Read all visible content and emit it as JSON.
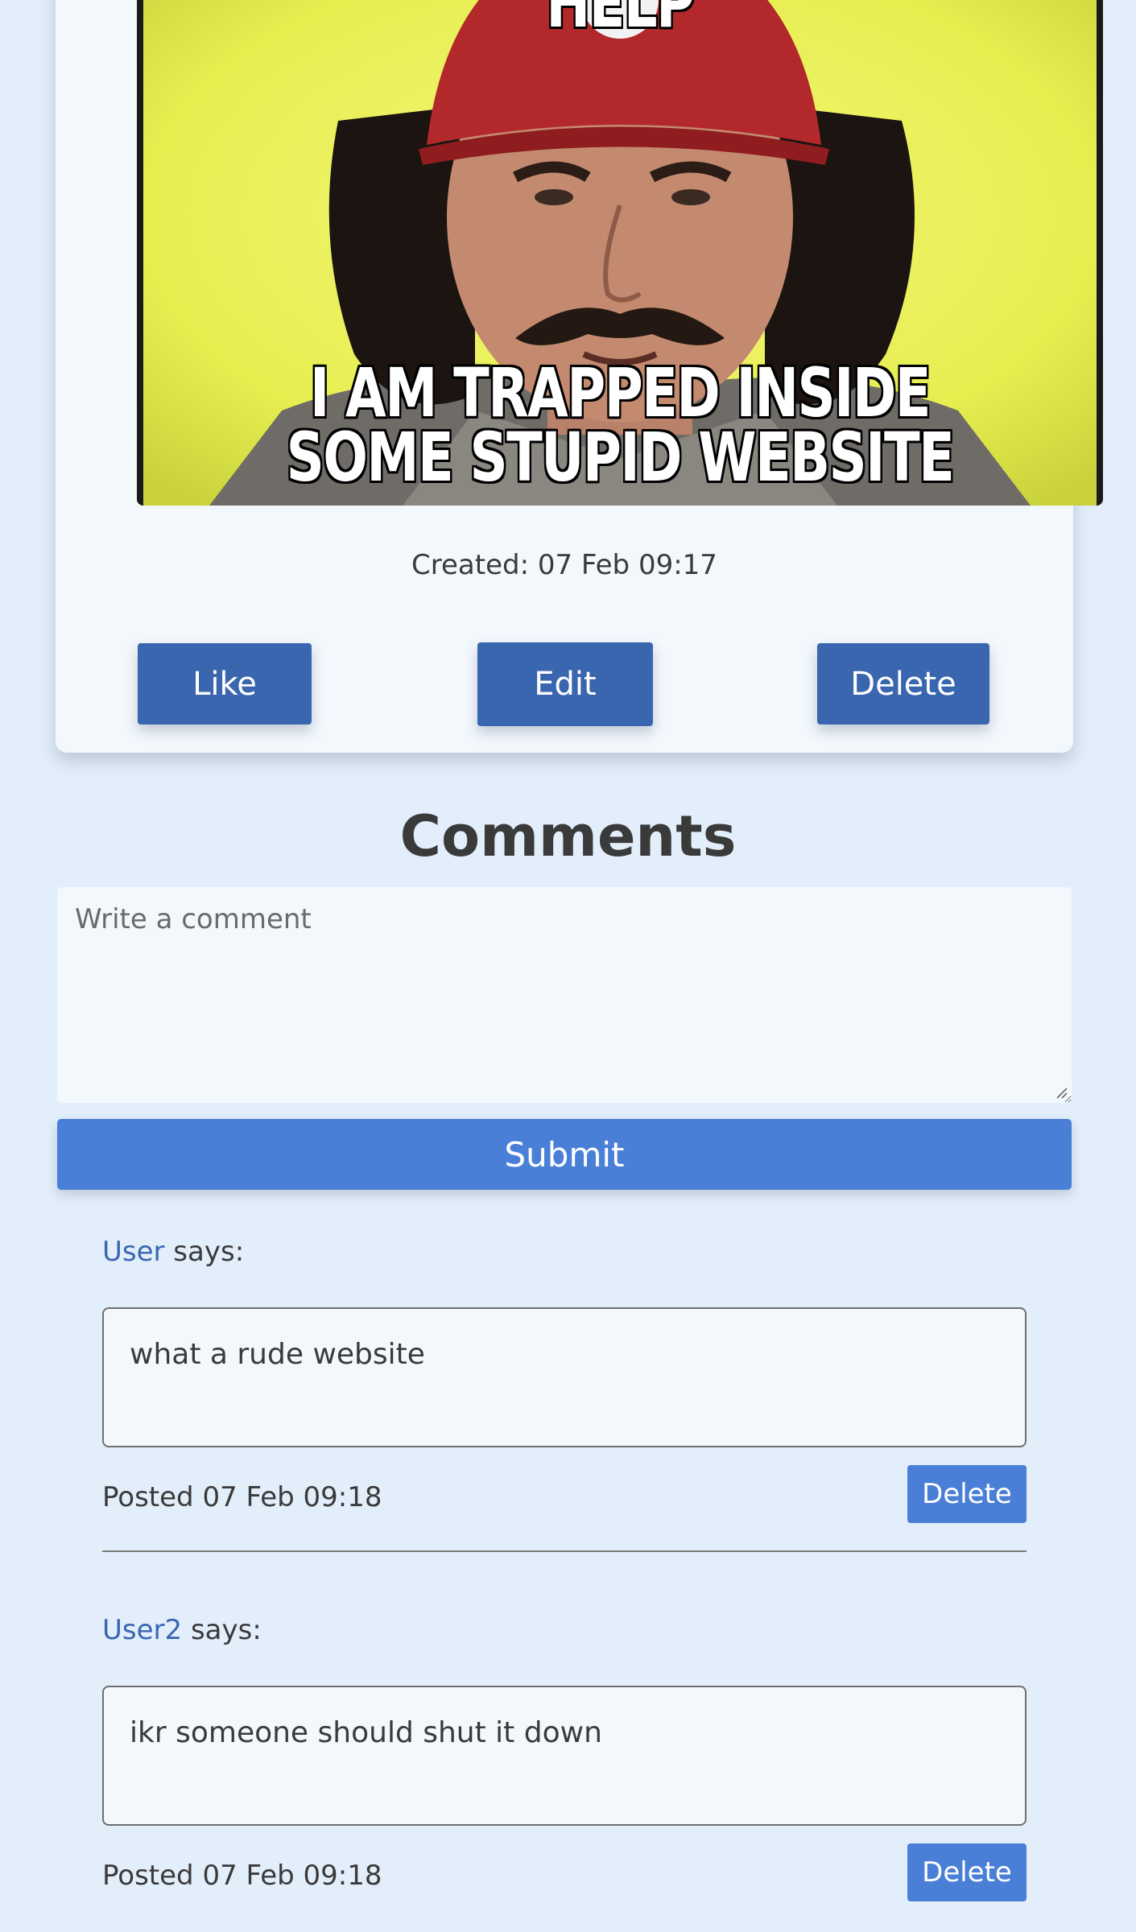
{
  "post": {
    "meme_top_text": "HELP",
    "meme_bottom_text": "I AM TRAPPED INSIDE SOME STUPID WEBSITE",
    "created": "Created: 07 Feb 09:17",
    "like_label": "Like",
    "edit_label": "Edit",
    "delete_label": "Delete"
  },
  "comments_section": {
    "title": "Comments",
    "input_placeholder": "Write a comment",
    "submit_label": "Submit",
    "items": [
      {
        "user": "User",
        "says": " says:",
        "text": "what a rude website",
        "posted": "Posted 07 Feb 09:18",
        "delete_label": "Delete"
      },
      {
        "user": "User2",
        "says": " says:",
        "text": "ikr someone should shut it down",
        "posted": "Posted 07 Feb 09:18",
        "delete_label": "Delete"
      }
    ]
  },
  "colors": {
    "background": "#e3eefb",
    "card": "#f3f8fd",
    "primary_button": "#3a66b0",
    "accent_button": "#4a7fd7",
    "link": "#3a66b0"
  }
}
